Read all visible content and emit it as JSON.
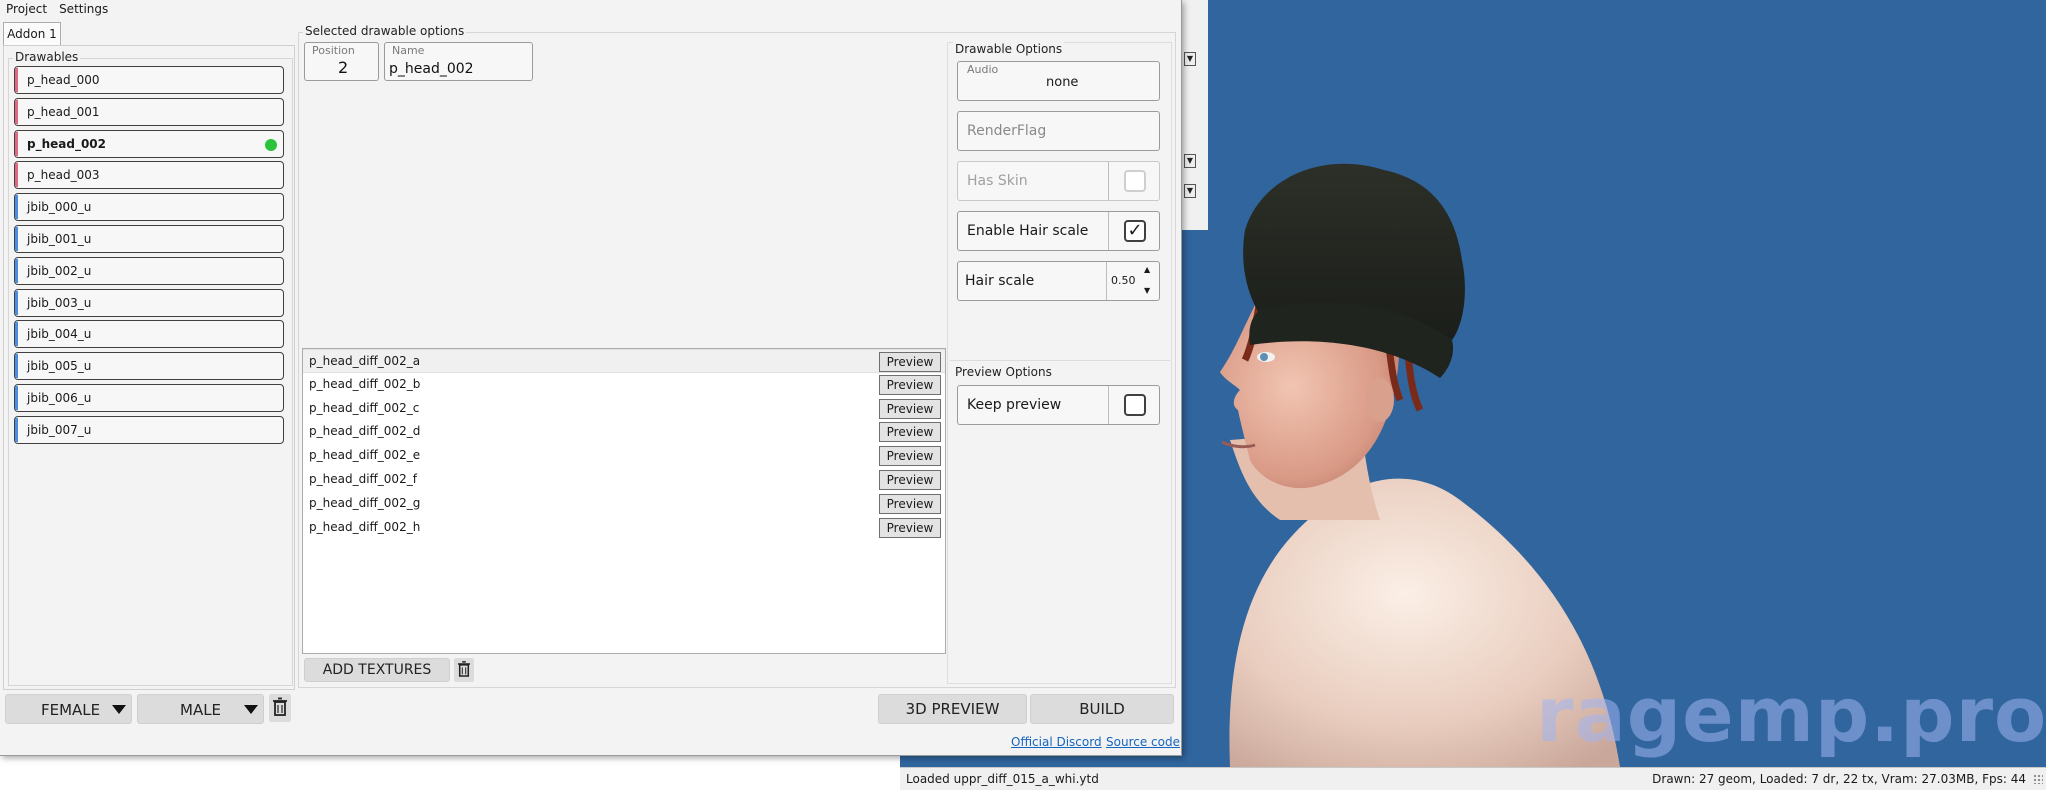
{
  "menu": {
    "project": "Project",
    "settings": "Settings"
  },
  "tab_label": "Addon 1",
  "drawables": {
    "title": "Drawables",
    "items": [
      {
        "label": "p_head_000",
        "gender": "female"
      },
      {
        "label": "p_head_001",
        "gender": "female"
      },
      {
        "label": "p_head_002",
        "gender": "female",
        "selected": true
      },
      {
        "label": "p_head_003",
        "gender": "female"
      },
      {
        "label": "jbib_000_u",
        "gender": "male"
      },
      {
        "label": "jbib_001_u",
        "gender": "male"
      },
      {
        "label": "jbib_002_u",
        "gender": "male"
      },
      {
        "label": "jbib_003_u",
        "gender": "male"
      },
      {
        "label": "jbib_004_u",
        "gender": "male"
      },
      {
        "label": "jbib_005_u",
        "gender": "male"
      },
      {
        "label": "jbib_006_u",
        "gender": "male"
      },
      {
        "label": "jbib_007_u",
        "gender": "male"
      }
    ],
    "female_button": "FEMALE",
    "male_button": "MALE"
  },
  "selected_options": {
    "title": "Selected drawable options",
    "position_label": "Position",
    "position_value": "2",
    "name_label": "Name",
    "name_value": "p_head_002"
  },
  "textures": {
    "items": [
      "p_head_diff_002_a",
      "p_head_diff_002_b",
      "p_head_diff_002_c",
      "p_head_diff_002_d",
      "p_head_diff_002_e",
      "p_head_diff_002_f",
      "p_head_diff_002_g",
      "p_head_diff_002_h"
    ],
    "preview_label": "Preview",
    "add_button": "ADD TEXTURES"
  },
  "drawable_options": {
    "title": "Drawable Options",
    "audio_label": "Audio",
    "audio_value": "none",
    "renderflag_placeholder": "RenderFlag",
    "has_skin": "Has Skin",
    "enable_hair_scale": "Enable Hair scale",
    "hair_scale_label": "Hair scale",
    "hair_scale_value": "0.50"
  },
  "preview_options": {
    "title": "Preview Options",
    "keep_preview": "Keep preview"
  },
  "actions": {
    "preview_3d": "3D PREVIEW",
    "build": "BUILD"
  },
  "links": {
    "discord": "Official Discord",
    "source": "Source code"
  },
  "viewport": {
    "status_left": "Loaded uppr_diff_015_a_whi.ytd",
    "status_right": "Drawn: 27 geom, Loaded: 7 dr, 22 tx, Vram: 27.03MB, Fps: 44",
    "watermark": "ragemp.pro"
  },
  "colors": {
    "female_stripe": "#e0687f",
    "male_stripe": "#4a8fe0",
    "selected_dot": "#2bc23c",
    "viewport_bg": "#30659e"
  }
}
